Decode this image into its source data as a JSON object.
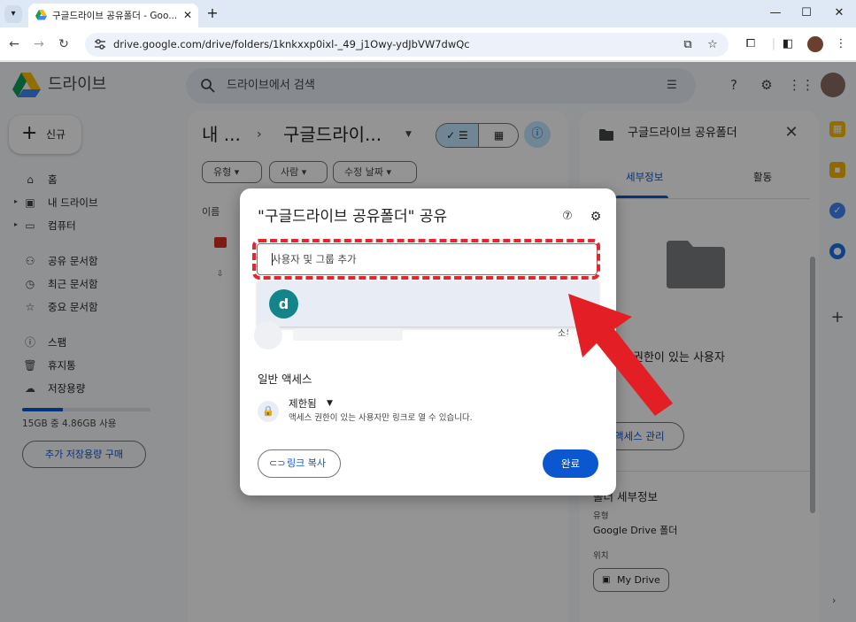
{
  "browser": {
    "tab_title": "구글드라이브 공유폴더 - Goo...",
    "tab_close": "✕",
    "new_tab": "+",
    "url": "drive.google.com/drive/folders/1knkxxp0ixl-_49_j1Owy-ydJbVW7dwQc",
    "icons": [
      "favicon-drive",
      "chevron-down",
      "back-arrow",
      "forward-arrow",
      "reload",
      "site-info",
      "translate",
      "star",
      "extensions",
      "side-panel",
      "minimize",
      "maximize",
      "close"
    ]
  },
  "app": {
    "name": "드라이브",
    "search_placeholder": "드라이브에서 검색",
    "new_label": "신규",
    "nav": [
      {
        "label": "홈",
        "icon": "home"
      },
      {
        "label": "내 드라이브",
        "icon": "my-drive"
      },
      {
        "label": "컴퓨터",
        "icon": "computer"
      },
      {
        "label": "공유 문서함",
        "icon": "shared"
      },
      {
        "label": "최근 문서함",
        "icon": "recent"
      },
      {
        "label": "중요 문서함",
        "icon": "star"
      },
      {
        "label": "스팸",
        "icon": "spam"
      },
      {
        "label": "휴지통",
        "icon": "trash"
      },
      {
        "label": "저장용량",
        "icon": "cloud"
      }
    ],
    "storage_text": "15GB 중 4.86GB 사용",
    "storage_fraction": 0.32,
    "buy_storage": "추가 저장용량 구매"
  },
  "main": {
    "crumb_root": "내 ...",
    "crumb_sep": "›",
    "crumb_current": "구글드라이...",
    "filters": [
      "유형",
      "사람",
      "수정 날짜"
    ],
    "column_name": "이름"
  },
  "details": {
    "title": "구글드라이브 공유폴더",
    "tabs": [
      "세부정보",
      "활동"
    ],
    "access_text": "권한이 있는 사용자",
    "manage_access": "액세스 관리",
    "folder_details": "폴더 세부정보",
    "type_label": "유형",
    "type_value": "Google Drive 폴더",
    "location_label": "위치",
    "location_value": "My Drive"
  },
  "dialog": {
    "title": "\"구글드라이브 공유폴더\" 공유",
    "add_placeholder": "사용자 및 그룹 추가",
    "suggest_avatar": "d",
    "owner_label": "소유자",
    "general_access": "일반 액세스",
    "restricted": "제한됨",
    "restricted_desc": "액세스 권한이 있는 사용자만 링크로 열 수 있습니다.",
    "copy_link": "링크 복사",
    "done": "완료"
  },
  "colors": {
    "highlight": "#e6262c",
    "primary": "#0b57d0",
    "arrow": "#e31e24"
  }
}
